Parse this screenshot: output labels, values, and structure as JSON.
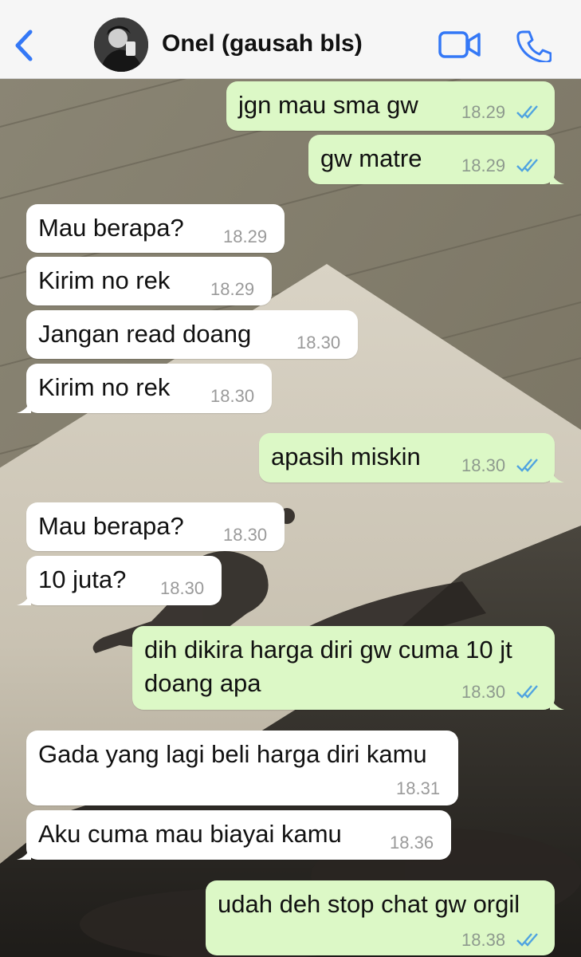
{
  "header": {
    "contact_name": "Onel (gausah bls)",
    "icons": {
      "back": "chevron-left-icon",
      "video": "video-camera-icon",
      "call": "phone-icon"
    },
    "accent_color": "#3478f6"
  },
  "colors": {
    "outgoing_bubble": "#dcf8c6",
    "incoming_bubble": "#ffffff",
    "read_ticks": "#4fa3e0"
  },
  "messages": [
    {
      "direction": "out",
      "text": "jgn mau sma gw",
      "time": "18.29",
      "read": true
    },
    {
      "direction": "out",
      "text": "gw matre",
      "time": "18.29",
      "read": true
    },
    {
      "direction": "in",
      "text": "Mau berapa?",
      "time": "18.29"
    },
    {
      "direction": "in",
      "text": "Kirim no rek",
      "time": "18.29"
    },
    {
      "direction": "in",
      "text": "Jangan read doang",
      "time": "18.30"
    },
    {
      "direction": "in",
      "text": "Kirim no rek",
      "time": "18.30"
    },
    {
      "direction": "out",
      "text": "apasih miskin",
      "time": "18.30",
      "read": true
    },
    {
      "direction": "in",
      "text": "Mau berapa?",
      "time": "18.30"
    },
    {
      "direction": "in",
      "text": "10 juta?",
      "time": "18.30"
    },
    {
      "direction": "out",
      "text_lines": [
        "dih dikira harga diri gw cuma 10 jt",
        "doang apa"
      ],
      "time": "18.30",
      "read": true
    },
    {
      "direction": "in",
      "text": "Gada yang lagi beli harga diri kamu",
      "time": "18.31"
    },
    {
      "direction": "in",
      "text": "Aku cuma mau biayai kamu",
      "time": "18.36"
    },
    {
      "direction": "out",
      "text": "udah deh stop chat gw orgil",
      "time": "18.38",
      "read": true
    }
  ]
}
